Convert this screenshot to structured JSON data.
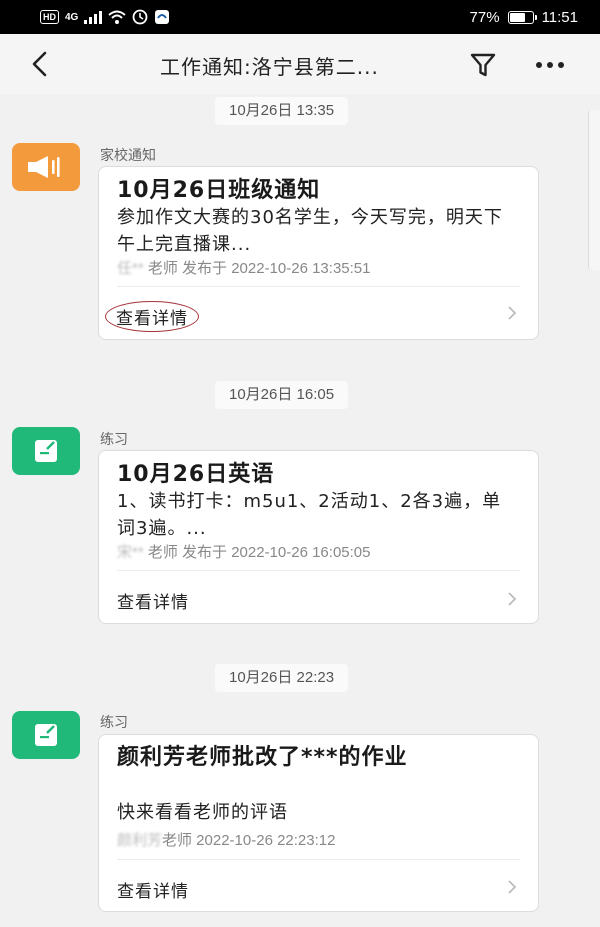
{
  "status_bar": {
    "hd": "HD",
    "network": "4G",
    "battery": "77%",
    "battery_level": 0.77,
    "time": "11:51"
  },
  "header": {
    "title": "工作通知:洛宁县第二...",
    "back_icon": "chevron-left-icon",
    "filter_icon": "filter-icon",
    "more_icon": "more-icon"
  },
  "messages": [
    {
      "time": "10月26日 13:35",
      "category": "家校通知",
      "icon": "megaphone-icon",
      "color": "#f39b3c",
      "title": "10月26日班级通知",
      "body": "参加作文大赛的30名学生，今天写完，明天下午上完直播课...",
      "sender_blurred": "任**",
      "meta": "老师 发布于 2022-10-26 13:35:51",
      "action": "查看详情"
    },
    {
      "time": "10月26日 16:05",
      "category": "练习",
      "icon": "edit-note-icon",
      "color": "#20b97a",
      "title": "10月26日英语",
      "body": "1、读书打卡：m5u1、2活动1、2各3遍，单词3遍。...",
      "sender_blurred": "宋**",
      "meta": "老师 发布于 2022-10-26 16:05:05",
      "action": "查看详情"
    },
    {
      "time": "10月26日 22:23",
      "category": "练习",
      "icon": "edit-note-icon",
      "color": "#20b97a",
      "title": "颜利芳老师批改了***的作业",
      "body": "快来看看老师的评语",
      "sender_blurred": "颜利芳",
      "meta": "老师  2022-10-26 22:23:12",
      "action": "查看详情"
    }
  ]
}
